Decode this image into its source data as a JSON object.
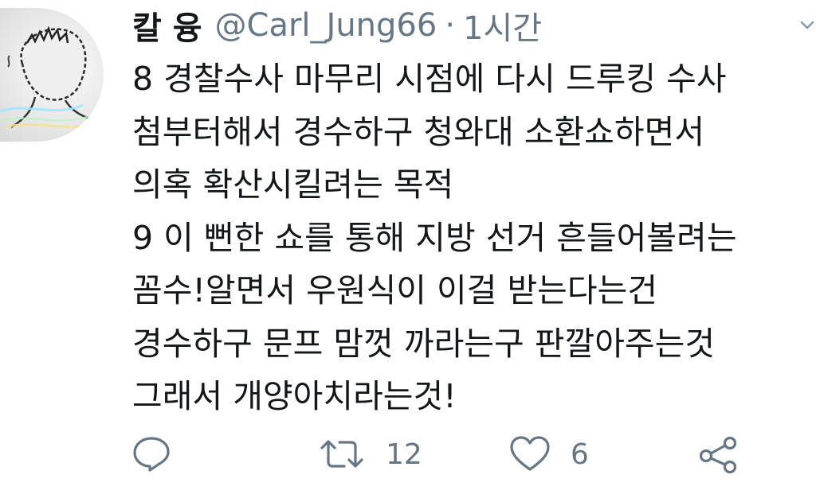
{
  "tweet": {
    "author": {
      "display_name": "칼 융",
      "handle": "@Carl_Jung66",
      "separator": "·",
      "time": "1시간"
    },
    "lines": [
      "8 경찰수사 마무리 시점에 다시 드루킹 수사",
      "첨부터해서 경수하구 청와대 소환쇼하면서",
      "의혹 확산시킬려는 목적",
      "9 이 뻔한 쇼를 통해 지방 선거 흔들어볼려는",
      "꼼수!알면서 우원식이 이걸 받는다는건",
      "경수하구 문프 맘껏 까라는구 판깔아주는것",
      "그래서 개양아치라는것!"
    ],
    "actions": {
      "reply_icon": "reply-icon",
      "retweet_icon": "retweet-icon",
      "retweet_count": "12",
      "like_icon": "heart-icon",
      "like_count": "6",
      "share_icon": "share-icon"
    },
    "colors": {
      "text": "#14171a",
      "secondary": "#657786"
    }
  }
}
